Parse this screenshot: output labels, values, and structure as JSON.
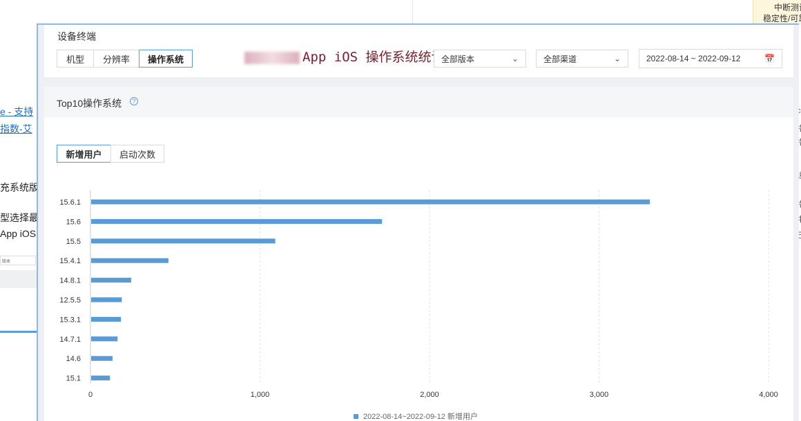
{
  "background": {
    "links": [
      "e - 支持",
      "指数-艾"
    ],
    "texts": [
      "充系统版本",
      "型选择最",
      "App iOS"
    ],
    "mini_select": "版本",
    "note_lines": [
      "中断测试",
      "稳定性/可靠"
    ],
    "right_marks": [
      "c",
      "指",
      "指",
      "设",
      "指",
      "中",
      "已"
    ]
  },
  "section": {
    "title": "设备终端",
    "segments": [
      "机型",
      "分辨率",
      "操作系统"
    ],
    "active_segment": "操作系统"
  },
  "watermark": "App iOS 操作系统统计",
  "filters": {
    "version": "全部版本",
    "channel": "全部渠道",
    "date_range": "2022-08-14 ~ 2022-09-12"
  },
  "chart_panel": {
    "title": "Top10操作系统",
    "help_icon": "question-circle-icon",
    "tabs": [
      "新增用户",
      "启动次数"
    ],
    "active_tab": "新增用户"
  },
  "chart_data": {
    "type": "bar",
    "orientation": "horizontal",
    "categories": [
      "15.6.1",
      "15.6",
      "15.5",
      "15.4.1",
      "14.8.1",
      "12.5.5",
      "15.3.1",
      "14.7.1",
      "14.6",
      "15.1"
    ],
    "series": [
      {
        "name": "2022-08-14~2022-09-12 新增用户",
        "values": [
          3300,
          1720,
          1090,
          460,
          240,
          185,
          180,
          160,
          130,
          115
        ],
        "color": "#5b9bd5"
      }
    ],
    "xlim": [
      0,
      4000
    ],
    "xticks": [
      0,
      1000,
      2000,
      3000,
      4000
    ],
    "xtick_labels": [
      "0",
      "1,000",
      "2,000",
      "3,000",
      "4,000"
    ],
    "grid": "vertical dashed",
    "legend_position": "bottom-center"
  }
}
